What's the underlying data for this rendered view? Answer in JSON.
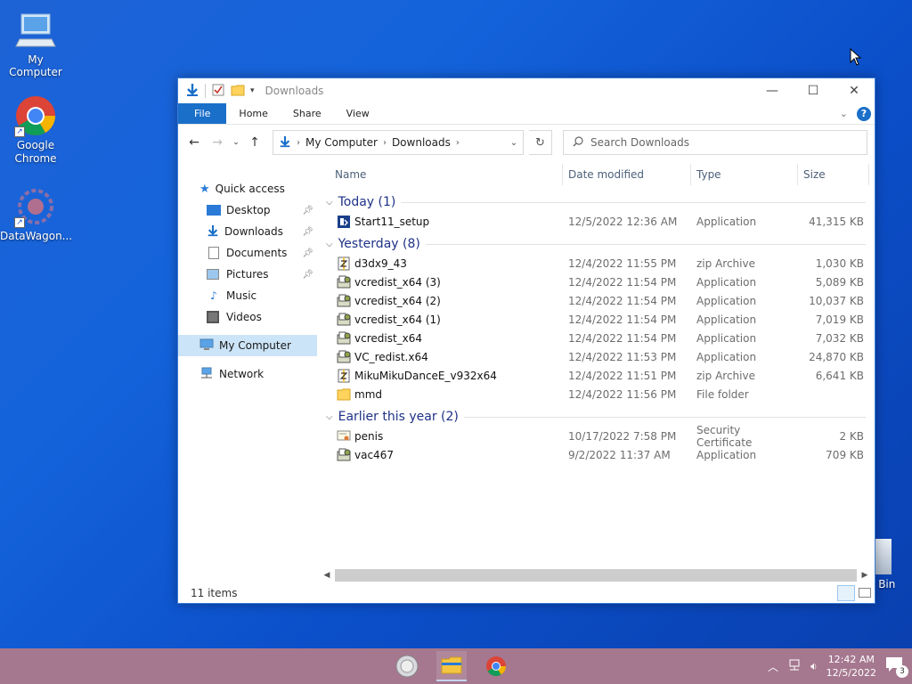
{
  "desktop": {
    "icons": [
      {
        "label": "My Computer"
      },
      {
        "label": "Google Chrome"
      },
      {
        "label": "DataWagon..."
      }
    ],
    "recycle_partial": "e Bin"
  },
  "window": {
    "title": "Downloads",
    "ribbon": {
      "file": "File",
      "home": "Home",
      "share": "Share",
      "view": "View",
      "help": "?"
    },
    "address": {
      "crumbs": [
        "My Computer",
        "Downloads"
      ]
    },
    "search_placeholder": "Search Downloads",
    "nav": {
      "quick_access": "Quick access",
      "items": [
        "Desktop",
        "Downloads",
        "Documents",
        "Pictures",
        "Music",
        "Videos"
      ],
      "my_computer": "My Computer",
      "network": "Network"
    },
    "columns": {
      "name": "Name",
      "date": "Date modified",
      "type": "Type",
      "size": "Size"
    },
    "groups": [
      {
        "label": "Today (1)",
        "rows": [
          {
            "name": "Start11_setup",
            "date": "12/5/2022 12:36 AM",
            "type": "Application",
            "size": "41,315 KB",
            "icon": "installer-icon"
          }
        ]
      },
      {
        "label": "Yesterday (8)",
        "rows": [
          {
            "name": "d3dx9_43",
            "date": "12/4/2022 11:55 PM",
            "type": "zip Archive",
            "size": "1,030 KB",
            "icon": "zip-icon"
          },
          {
            "name": "vcredist_x64 (3)",
            "date": "12/4/2022 11:54 PM",
            "type": "Application",
            "size": "5,089 KB",
            "icon": "setup-icon"
          },
          {
            "name": "vcredist_x64 (2)",
            "date": "12/4/2022 11:54 PM",
            "type": "Application",
            "size": "10,037 KB",
            "icon": "setup-icon"
          },
          {
            "name": "vcredist_x64 (1)",
            "date": "12/4/2022 11:54 PM",
            "type": "Application",
            "size": "7,019 KB",
            "icon": "setup-icon"
          },
          {
            "name": "vcredist_x64",
            "date": "12/4/2022 11:54 PM",
            "type": "Application",
            "size": "7,032 KB",
            "icon": "setup-icon"
          },
          {
            "name": "VC_redist.x64",
            "date": "12/4/2022 11:53 PM",
            "type": "Application",
            "size": "24,870 KB",
            "icon": "setup-icon"
          },
          {
            "name": "MikuMikuDanceE_v932x64",
            "date": "12/4/2022 11:51 PM",
            "type": "zip Archive",
            "size": "6,641 KB",
            "icon": "zip-icon"
          },
          {
            "name": "mmd",
            "date": "12/4/2022 11:56 PM",
            "type": "File folder",
            "size": "",
            "icon": "folder-icon"
          }
        ]
      },
      {
        "label": "Earlier this year (2)",
        "rows": [
          {
            "name": "penis",
            "date": "10/17/2022 7:58 PM",
            "type": "Security Certificate",
            "size": "2 KB",
            "icon": "certificate-icon"
          },
          {
            "name": "vac467",
            "date": "9/2/2022 11:37 AM",
            "type": "Application",
            "size": "709 KB",
            "icon": "setup-icon"
          }
        ]
      }
    ],
    "status": "11 items"
  },
  "taskbar": {
    "time": "12:42 AM",
    "date": "12/5/2022",
    "notifications": "3"
  },
  "colors": {
    "accent": "#1a6fc9",
    "taskbar": "#a5788f",
    "group_header": "#1e3287",
    "selected": "#cce4f7"
  }
}
